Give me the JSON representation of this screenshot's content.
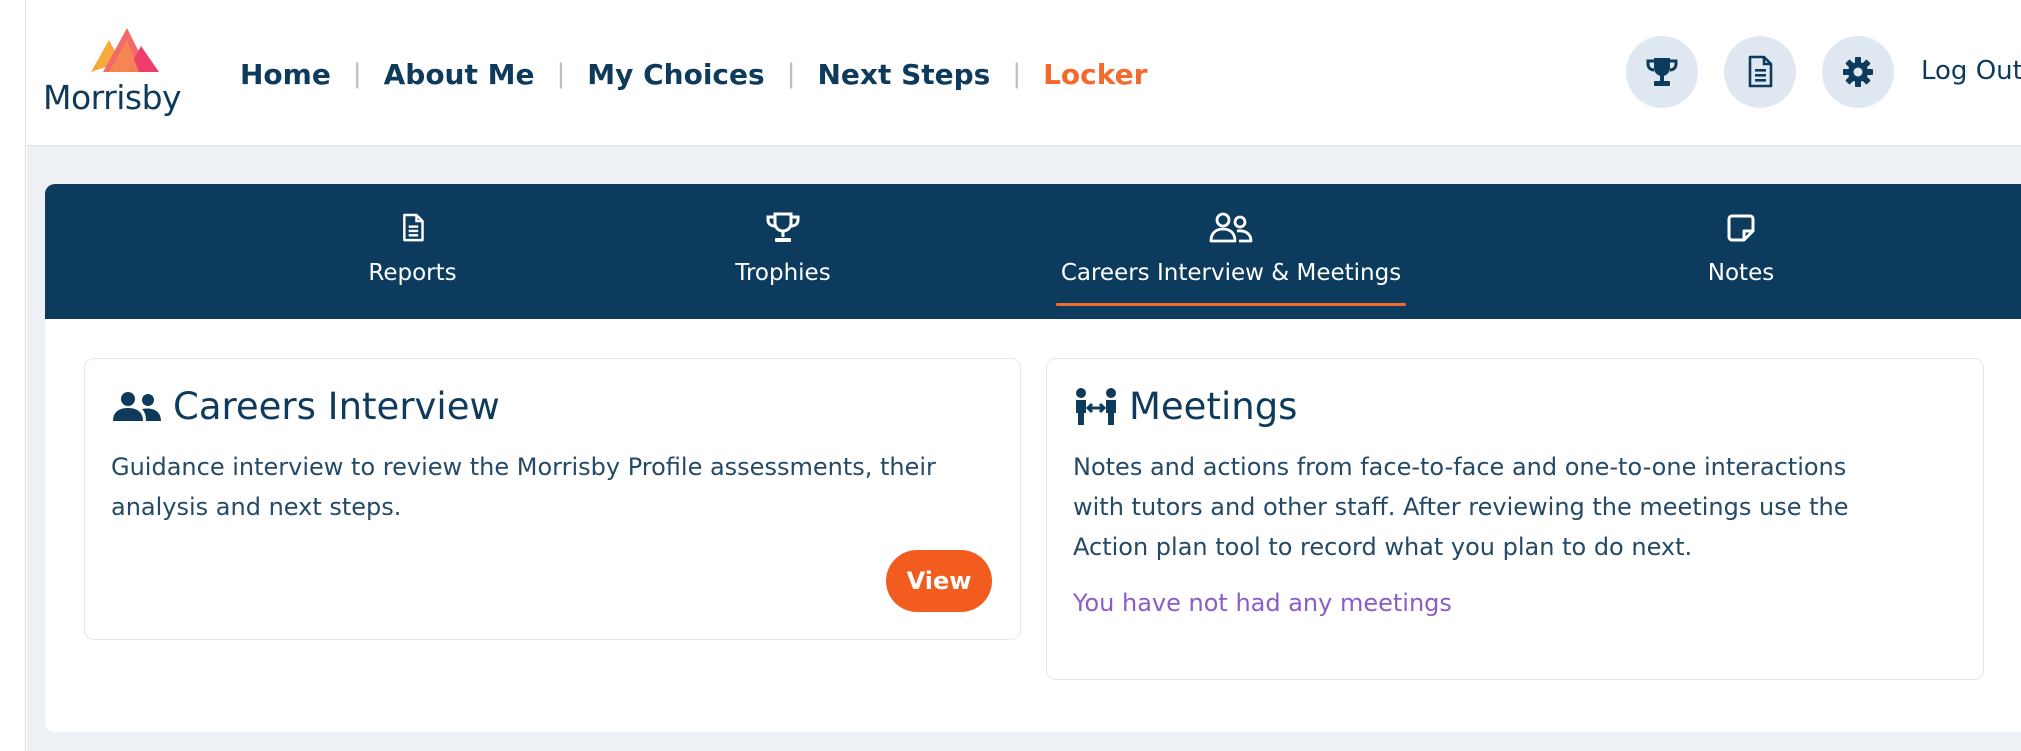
{
  "brand": {
    "logo_text": "Morrisby",
    "accent": "#f26a2e",
    "navy": "#0e3a5c"
  },
  "nav": {
    "items": [
      {
        "label": "Home",
        "active": false
      },
      {
        "label": "About Me",
        "active": false
      },
      {
        "label": "My Choices",
        "active": false
      },
      {
        "label": "Next Steps",
        "active": false
      },
      {
        "label": "Locker",
        "active": true
      }
    ],
    "separator": "|",
    "icons": [
      "trophy-icon",
      "report-icon",
      "gear-icon"
    ],
    "logout_label": "Log Out"
  },
  "locker": {
    "tabs": [
      {
        "label": "Reports",
        "icon": "report-icon",
        "active": false
      },
      {
        "label": "Trophies",
        "icon": "trophy-icon",
        "active": false
      },
      {
        "label": "Careers Interview & Meetings",
        "icon": "users-icon",
        "active": true
      },
      {
        "label": "Notes",
        "icon": "note-icon",
        "active": false
      }
    ]
  },
  "careers_interview": {
    "title": "Careers Interview",
    "icon": "users-icon",
    "description_line1": "Guidance interview to review the Morrisby Profile assessments, their",
    "description_line2": "analysis and next steps.",
    "view_label": "View"
  },
  "meetings": {
    "title": "Meetings",
    "icon": "meeting-icon",
    "description_line1": "Notes and actions from face-to-face and one-to-one interactions",
    "description_line2": "with tutors and other staff. After reviewing the meetings use the",
    "description_line3": "Action plan tool to record what you plan to do next.",
    "empty_message": "You have not had any meetings"
  }
}
